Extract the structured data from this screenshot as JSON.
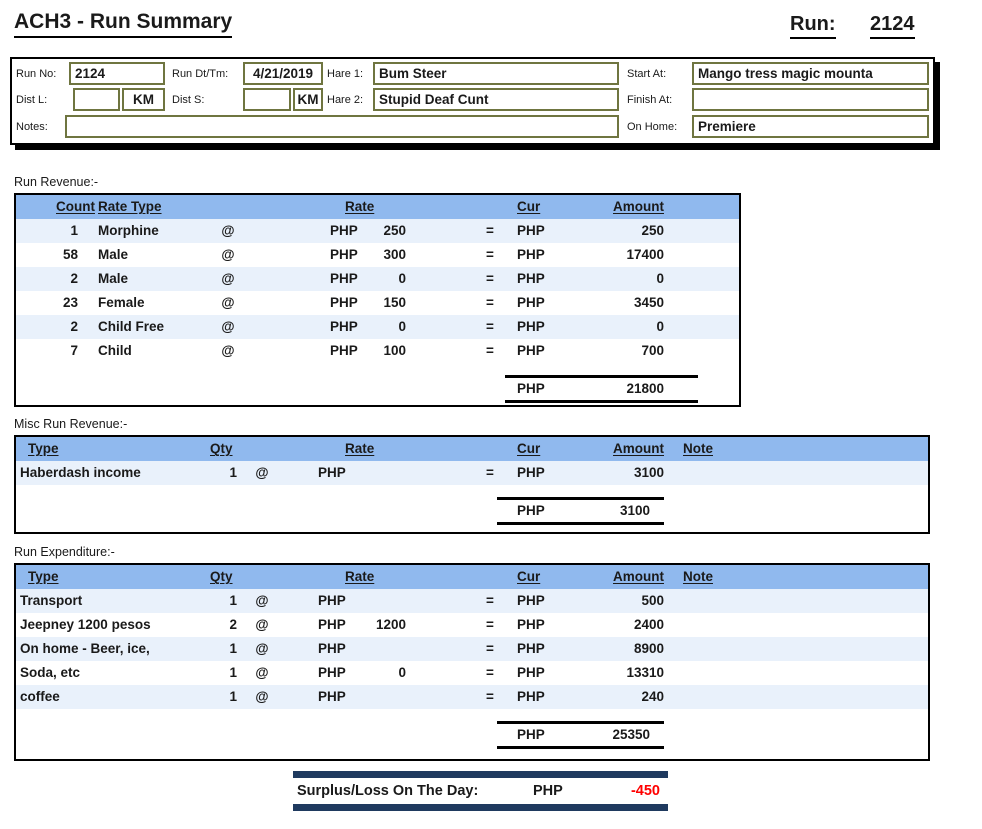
{
  "title": "ACH3 - Run Summary",
  "run": {
    "label": "Run:",
    "number": "2124"
  },
  "header": {
    "run_no_label": "Run No:",
    "run_no": "2124",
    "run_dt_label": "Run Dt/Tm:",
    "run_dt": "4/21/2019",
    "hare1_label": "Hare 1:",
    "hare1": "Bum Steer",
    "start_at_label": "Start At:",
    "start_at": "Mango tress magic mounta",
    "dist_l_label": "Dist L:",
    "dist_l": "",
    "km1": "KM",
    "dist_s_label": "Dist S:",
    "dist_s": "",
    "km2": "KM",
    "hare2_label": "Hare 2:",
    "hare2": "Stupid Deaf Cunt",
    "finish_at_label": "Finish At:",
    "finish_at": "",
    "notes_label": "Notes:",
    "notes": "",
    "on_home_label": "On Home:",
    "on_home": "Premiere"
  },
  "revenue": {
    "section_label": "Run Revenue:-",
    "headers": {
      "count": "Count",
      "rate_type": "Rate Type",
      "rate": "Rate",
      "cur": "Cur",
      "amount": "Amount"
    },
    "rows": [
      {
        "count": "1",
        "rate_type": "Morphine",
        "at": "@",
        "rate_cur": "PHP",
        "rate": "250",
        "eq": "=",
        "cur": "PHP",
        "amount": "250"
      },
      {
        "count": "58",
        "rate_type": "Male",
        "at": "@",
        "rate_cur": "PHP",
        "rate": "300",
        "eq": "=",
        "cur": "PHP",
        "amount": "17400"
      },
      {
        "count": "2",
        "rate_type": "Male",
        "at": "@",
        "rate_cur": "PHP",
        "rate": "0",
        "eq": "=",
        "cur": "PHP",
        "amount": "0"
      },
      {
        "count": "23",
        "rate_type": "Female",
        "at": "@",
        "rate_cur": "PHP",
        "rate": "150",
        "eq": "=",
        "cur": "PHP",
        "amount": "3450"
      },
      {
        "count": "2",
        "rate_type": "Child Free",
        "at": "@",
        "rate_cur": "PHP",
        "rate": "0",
        "eq": "=",
        "cur": "PHP",
        "amount": "0"
      },
      {
        "count": "7",
        "rate_type": "Child",
        "at": "@",
        "rate_cur": "PHP",
        "rate": "100",
        "eq": "=",
        "cur": "PHP",
        "amount": "700"
      }
    ],
    "total": {
      "cur": "PHP",
      "amount": "21800"
    }
  },
  "misc_revenue": {
    "section_label": "Misc Run Revenue:-",
    "headers": {
      "type": "Type",
      "qty": "Qty",
      "rate": "Rate",
      "cur": "Cur",
      "amount": "Amount",
      "note": "Note"
    },
    "rows": [
      {
        "type": "Haberdash income",
        "qty": "1",
        "at": "@",
        "rate_cur": "PHP",
        "rate": "",
        "eq": "=",
        "cur": "PHP",
        "amount": "3100",
        "note": ""
      }
    ],
    "total": {
      "cur": "PHP",
      "amount": "3100"
    }
  },
  "expenditure": {
    "section_label": "Run Expenditure:-",
    "headers": {
      "type": "Type",
      "qty": "Qty",
      "rate": "Rate",
      "cur": "Cur",
      "amount": "Amount",
      "note": "Note"
    },
    "rows": [
      {
        "type": "Transport",
        "qty": "1",
        "at": "@",
        "rate_cur": "PHP",
        "rate": "",
        "eq": "=",
        "cur": "PHP",
        "amount": "500",
        "note": ""
      },
      {
        "type": "Jeepney 1200 pesos",
        "qty": "2",
        "at": "@",
        "rate_cur": "PHP",
        "rate": "1200",
        "eq": "=",
        "cur": "PHP",
        "amount": "2400",
        "note": ""
      },
      {
        "type": "On home - Beer, ice,",
        "qty": "1",
        "at": "@",
        "rate_cur": "PHP",
        "rate": "",
        "eq": "=",
        "cur": "PHP",
        "amount": "8900",
        "note": ""
      },
      {
        "type": "Soda, etc",
        "qty": "1",
        "at": "@",
        "rate_cur": "PHP",
        "rate": "0",
        "eq": "=",
        "cur": "PHP",
        "amount": "13310",
        "note": ""
      },
      {
        "type": "coffee",
        "qty": "1",
        "at": "@",
        "rate_cur": "PHP",
        "rate": "",
        "eq": "=",
        "cur": "PHP",
        "amount": "240",
        "note": ""
      }
    ],
    "total": {
      "cur": "PHP",
      "amount": "25350"
    }
  },
  "surplus": {
    "label": "Surplus/Loss On The Day:",
    "cur": "PHP",
    "amount": "-450"
  },
  "colors": {
    "table_header_blue": "#90B9EE",
    "banded_row_blue": "#E9F1FB",
    "field_border_olive": "#6F7540",
    "surplus_bar_navy": "#1F3A5F",
    "negative_red": "#FF0000"
  }
}
